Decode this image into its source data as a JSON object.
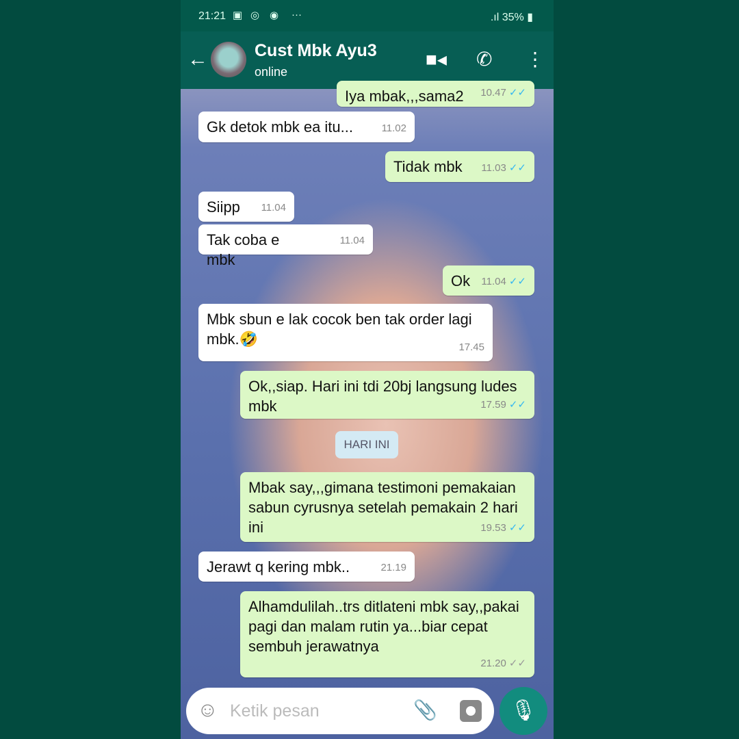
{
  "status": {
    "time": "21:21",
    "battery": "35%"
  },
  "header": {
    "title": "Cust Mbk Ayu3",
    "subtitle": "online"
  },
  "messages": [
    {
      "dir": "out",
      "text": "Iya mbak,,,sama2",
      "time": "10.47",
      "ticks": "read"
    },
    {
      "dir": "in",
      "text": "Gk detok mbk ea itu...",
      "time": "11.02"
    },
    {
      "dir": "out",
      "text": "Tidak mbk",
      "time": "11.03",
      "ticks": "read"
    },
    {
      "dir": "in",
      "text": "Siipp",
      "time": "11.04"
    },
    {
      "dir": "in",
      "text": "Tak coba e mbk",
      "time": "11.04"
    },
    {
      "dir": "out",
      "text": "Ok",
      "time": "11.04",
      "ticks": "read"
    },
    {
      "dir": "in",
      "text": "Mbk sbun e lak cocok ben tak order lagi mbk.🤣",
      "time": "17.45"
    },
    {
      "dir": "out",
      "text": "Ok,,siap. Hari ini tdi 20bj langsung ludes mbk",
      "time": "17.59",
      "ticks": "read"
    },
    {
      "dir": "out",
      "text": "Mbak say,,,gimana testimoni pemakaian sabun cyrusnya setelah pemakain 2 hari ini",
      "time": "19.53",
      "ticks": "read"
    },
    {
      "dir": "in",
      "text": "Jerawt q kering mbk..",
      "time": "21.19"
    },
    {
      "dir": "out",
      "text": "Alhamdulilah..trs ditlateni mbk say,,pakai pagi dan malam rutin ya...biar cepat sembuh jerawatnya",
      "time": "21.20",
      "ticks": "delivered"
    }
  ],
  "date_divider": "HARI INI",
  "input": {
    "placeholder": "Ketik pesan"
  },
  "colors": {
    "header": "#075e54",
    "outgoing": "#dcf8c6",
    "incoming": "#ffffff",
    "read_tick": "#34b7f1"
  }
}
